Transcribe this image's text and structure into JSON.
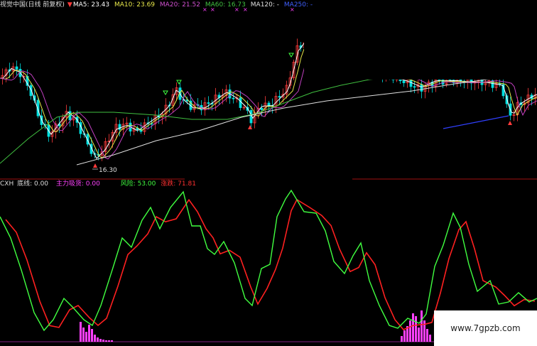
{
  "top_legend": {
    "title": "视觉中国(日线 前复权)",
    "ma5": "MA5: 23.43",
    "ma10": "MA10: 23.69",
    "ma20": "MA20: 21.52",
    "ma60": "MA60: 16.73",
    "ma120": "MA120: -",
    "ma250": "MA250: -"
  },
  "low_label": "16.30",
  "indicator_legend": {
    "name": "CXH",
    "bottom_line": "底线: 0.00",
    "main_force": "主力吸货: 0.00",
    "risk": "风险: 53.00",
    "rise_fall": "涨跌: 71.81"
  },
  "watermark": "www.7gpzb.com",
  "colors": {
    "up": "#ff3b3b",
    "down": "#00e0e0",
    "ma5": "#ffffff",
    "ma10": "#e8e84a",
    "ma20": "#c040c0",
    "ma60": "#40c040",
    "ma120": "#e0e0e0",
    "indicator_green": "#40ff40",
    "indicator_red": "#ff2020",
    "histogram": "#ff40ff",
    "divider": "#a01010",
    "trend_blue": "#3040ff"
  }
}
